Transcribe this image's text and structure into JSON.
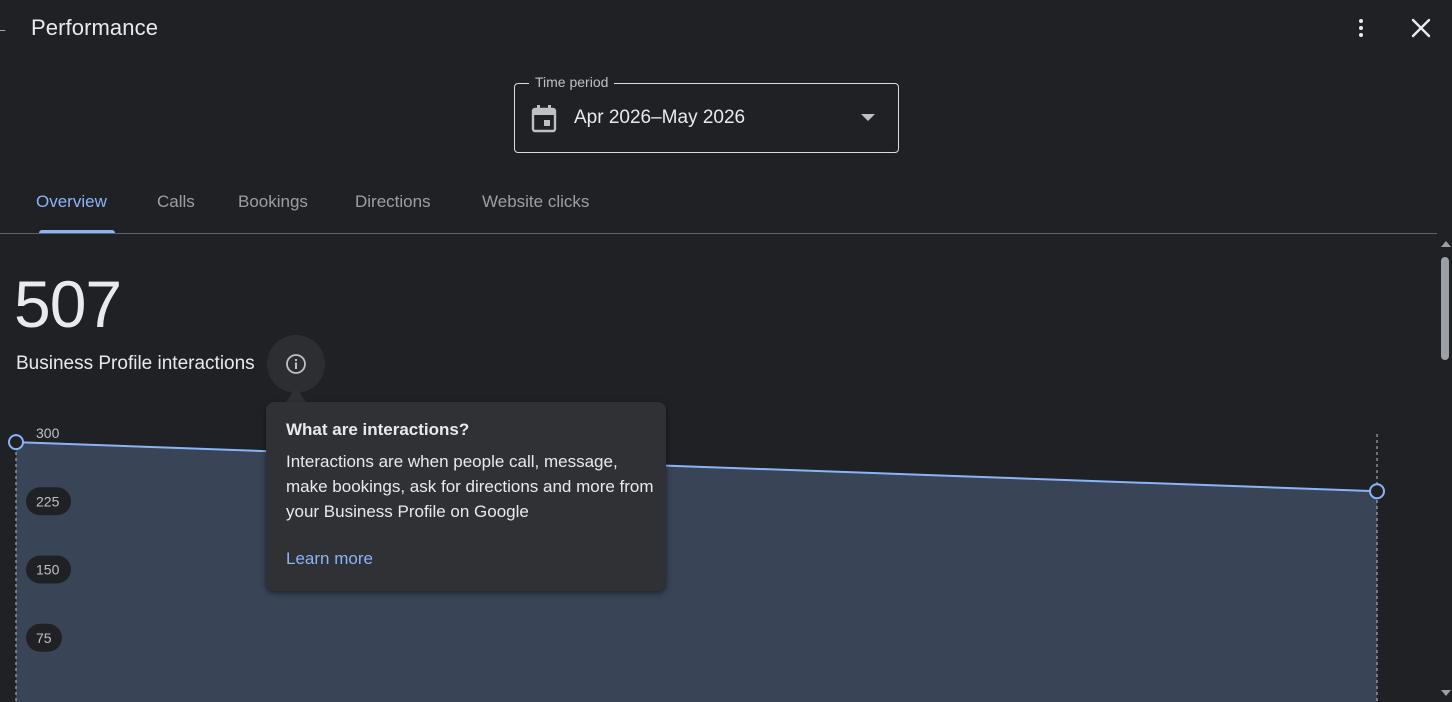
{
  "header": {
    "title": "Performance",
    "back_icon": "arrow-back-icon",
    "more_icon": "more-vert-icon",
    "close_icon": "close-icon"
  },
  "time_period": {
    "label": "Time period",
    "value": "Apr 2026–May 2026",
    "icon": "calendar-icon"
  },
  "tabs": [
    {
      "label": "Overview",
      "active": true
    },
    {
      "label": "Calls",
      "active": false
    },
    {
      "label": "Bookings",
      "active": false
    },
    {
      "label": "Directions",
      "active": false
    },
    {
      "label": "Website clicks",
      "active": false
    }
  ],
  "metric": {
    "value": "507",
    "label": "Business Profile interactions",
    "info_icon": "info-icon"
  },
  "tooltip": {
    "title": "What are interactions?",
    "body": "Interactions are when people call, message, make bookings, ask for directions and more from your Business Profile on Google",
    "link": "Learn more"
  },
  "colors": {
    "accent": "#8ab4f8",
    "background": "#202124",
    "area_fill": "#394457",
    "surface": "#303134"
  },
  "chart_data": {
    "type": "area",
    "x": [
      0,
      1
    ],
    "y_ticks": [
      "300",
      "225",
      "150",
      "75"
    ],
    "ylim": [
      0,
      300
    ],
    "series": [
      {
        "values": [
          290,
          236
        ]
      }
    ],
    "grid": false
  }
}
